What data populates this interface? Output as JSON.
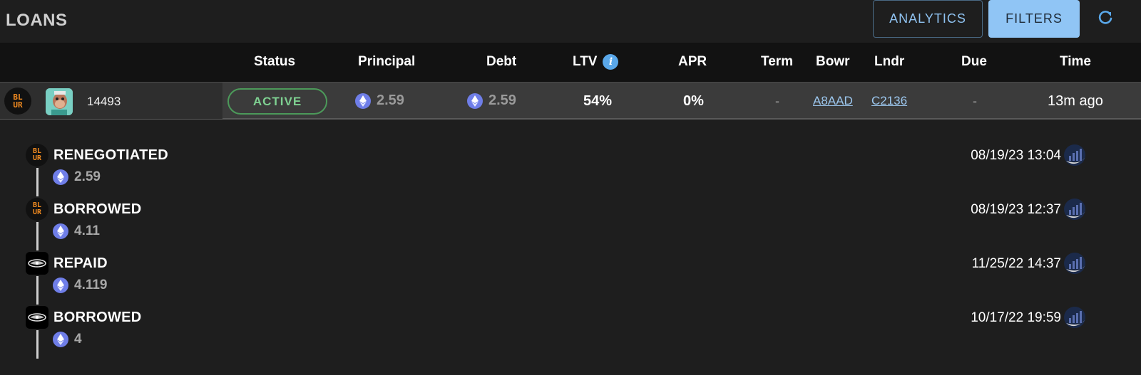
{
  "header": {
    "title": "LOANS",
    "analytics_label": "ANALYTICS",
    "filters_label": "FILTERS"
  },
  "columns": {
    "status": "Status",
    "principal": "Principal",
    "debt": "Debt",
    "ltv": "LTV",
    "apr": "APR",
    "term": "Term",
    "bowr": "Bowr",
    "lndr": "Lndr",
    "due": "Due",
    "time": "Time"
  },
  "loan": {
    "platform_logo": "BLUR",
    "token_id": "14493",
    "status": "ACTIVE",
    "principal": "2.59",
    "debt": "2.59",
    "ltv": "54%",
    "apr": "0%",
    "term": "-",
    "borrower": "A8AAD",
    "lender": "C2136",
    "due": "-",
    "time": "13m ago"
  },
  "events": [
    {
      "logo_text": "BLUR",
      "logo_type": "blur",
      "title": "RENEGOTIATED",
      "amount": "2.59",
      "datetime": "08/19/23 13:04"
    },
    {
      "logo_text": "BLUR",
      "logo_type": "blur",
      "title": "BORROWED",
      "amount": "4.11",
      "datetime": "08/19/23 12:37"
    },
    {
      "logo_type": "other",
      "title": "REPAID",
      "amount": "4.119",
      "datetime": "11/25/22 14:37"
    },
    {
      "logo_type": "other",
      "title": "BORROWED",
      "amount": "4",
      "datetime": "10/17/22 19:59"
    }
  ],
  "colors": {
    "accent": "#90c5f5",
    "active_green": "#7ed091",
    "eth": "#6f7ee8",
    "blur_orange": "#f08a20"
  },
  "icons": {
    "refresh": "refresh-icon",
    "info": "info-icon",
    "eth": "ethereum-icon",
    "chart": "chart-icon"
  }
}
